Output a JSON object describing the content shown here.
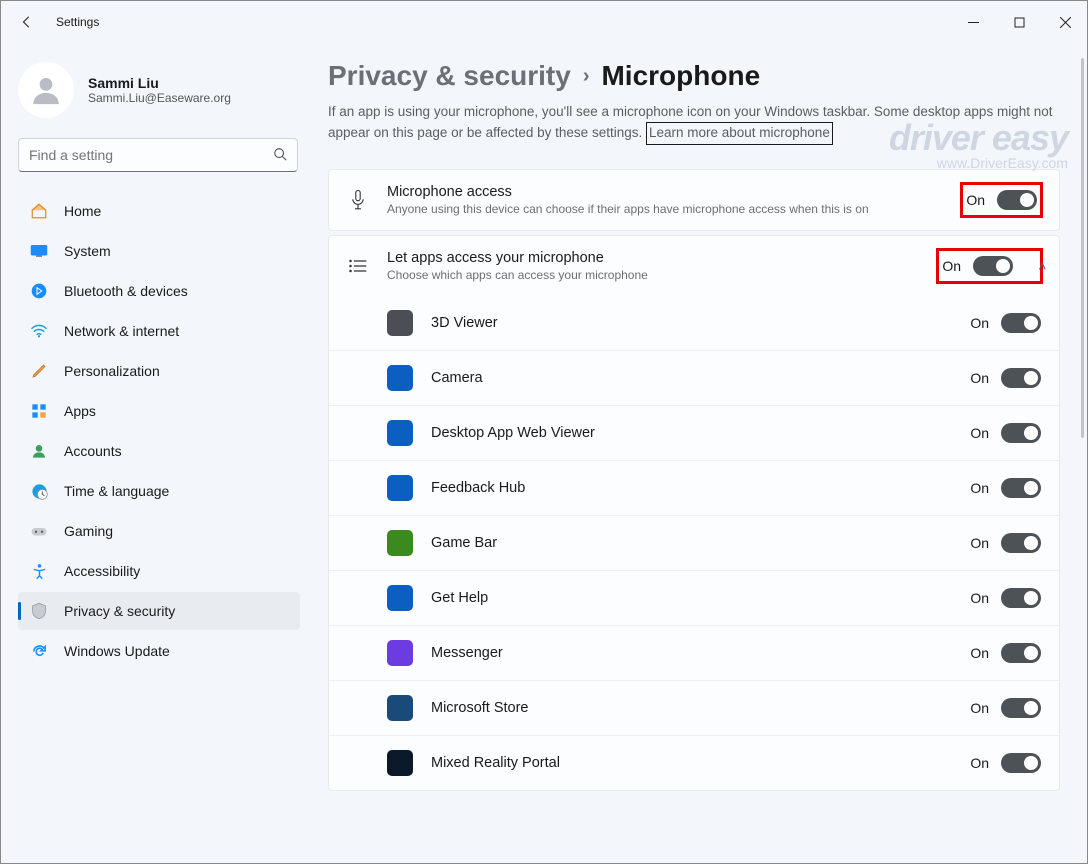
{
  "window": {
    "title": "Settings"
  },
  "user": {
    "name": "Sammi Liu",
    "email": "Sammi.Liu@Easeware.org"
  },
  "search": {
    "placeholder": "Find a setting"
  },
  "sidebar": {
    "items": [
      {
        "label": "Home"
      },
      {
        "label": "System"
      },
      {
        "label": "Bluetooth & devices"
      },
      {
        "label": "Network & internet"
      },
      {
        "label": "Personalization"
      },
      {
        "label": "Apps"
      },
      {
        "label": "Accounts"
      },
      {
        "label": "Time & language"
      },
      {
        "label": "Gaming"
      },
      {
        "label": "Accessibility"
      },
      {
        "label": "Privacy & security"
      },
      {
        "label": "Windows Update"
      }
    ]
  },
  "breadcrumb": {
    "parent": "Privacy & security",
    "current": "Microphone"
  },
  "description": {
    "text": "If an app is using your microphone, you'll see a microphone icon on your Windows taskbar. Some desktop apps might not appear on this page or be affected by these settings. ",
    "link": "Learn more about microphone"
  },
  "cards": {
    "mic_access": {
      "title": "Microphone access",
      "sub": "Anyone using this device can choose if their apps have microphone access when this is on",
      "state": "On"
    },
    "let_apps": {
      "title": "Let apps access your microphone",
      "sub": "Choose which apps can access your microphone",
      "state": "On"
    }
  },
  "apps": [
    {
      "name": "3D Viewer",
      "bg": "#4b4f55",
      "state": "On"
    },
    {
      "name": "Camera",
      "bg": "#0a5fc0",
      "state": "On"
    },
    {
      "name": "Desktop App Web Viewer",
      "bg": "#0a5fc0",
      "state": "On"
    },
    {
      "name": "Feedback Hub",
      "bg": "#0a5fc0",
      "state": "On"
    },
    {
      "name": "Game Bar",
      "bg": "#3a8a1f",
      "state": "On"
    },
    {
      "name": "Get Help",
      "bg": "#0a5fc0",
      "state": "On"
    },
    {
      "name": "Messenger",
      "bg": "#6d3ce0",
      "state": "On"
    },
    {
      "name": "Microsoft Store",
      "bg": "#1a4a7a",
      "state": "On"
    },
    {
      "name": "Mixed Reality Portal",
      "bg": "#0a1a2a",
      "state": "On"
    }
  ],
  "watermark": {
    "brand": "driver easy",
    "url": "www.DriverEasy.com"
  }
}
